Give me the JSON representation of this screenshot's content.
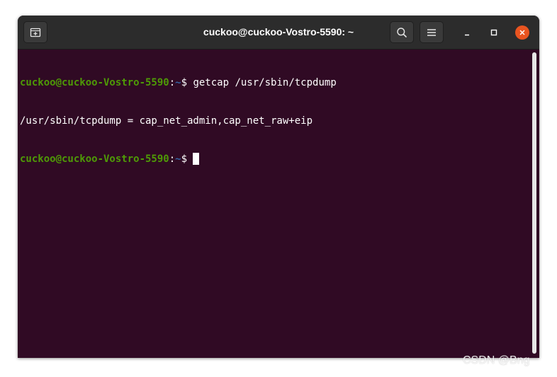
{
  "window": {
    "title": "cuckoo@cuckoo-Vostro-5590: ~"
  },
  "titlebar": {
    "new_tab_icon": "new-tab-icon",
    "search_icon": "search-icon",
    "menu_icon": "hamburger-menu-icon",
    "minimize_icon": "minimize-icon",
    "maximize_icon": "maximize-icon",
    "close_icon": "close-icon"
  },
  "terminal": {
    "lines": [
      {
        "user_host": "cuckoo@cuckoo-Vostro-5590",
        "sep": ":",
        "path": "~",
        "symbol": "$ ",
        "command": "getcap /usr/sbin/tcpdump"
      },
      {
        "output": "/usr/sbin/tcpdump = cap_net_admin,cap_net_raw+eip"
      },
      {
        "user_host": "cuckoo@cuckoo-Vostro-5590",
        "sep": ":",
        "path": "~",
        "symbol": "$ "
      }
    ]
  },
  "colors": {
    "terminal_bg": "#300a24",
    "prompt_user": "#4e9a06",
    "prompt_path": "#3465a4",
    "close_button": "#e95420",
    "titlebar": "#2c2c2c"
  },
  "watermark": "CSDN @Bng"
}
